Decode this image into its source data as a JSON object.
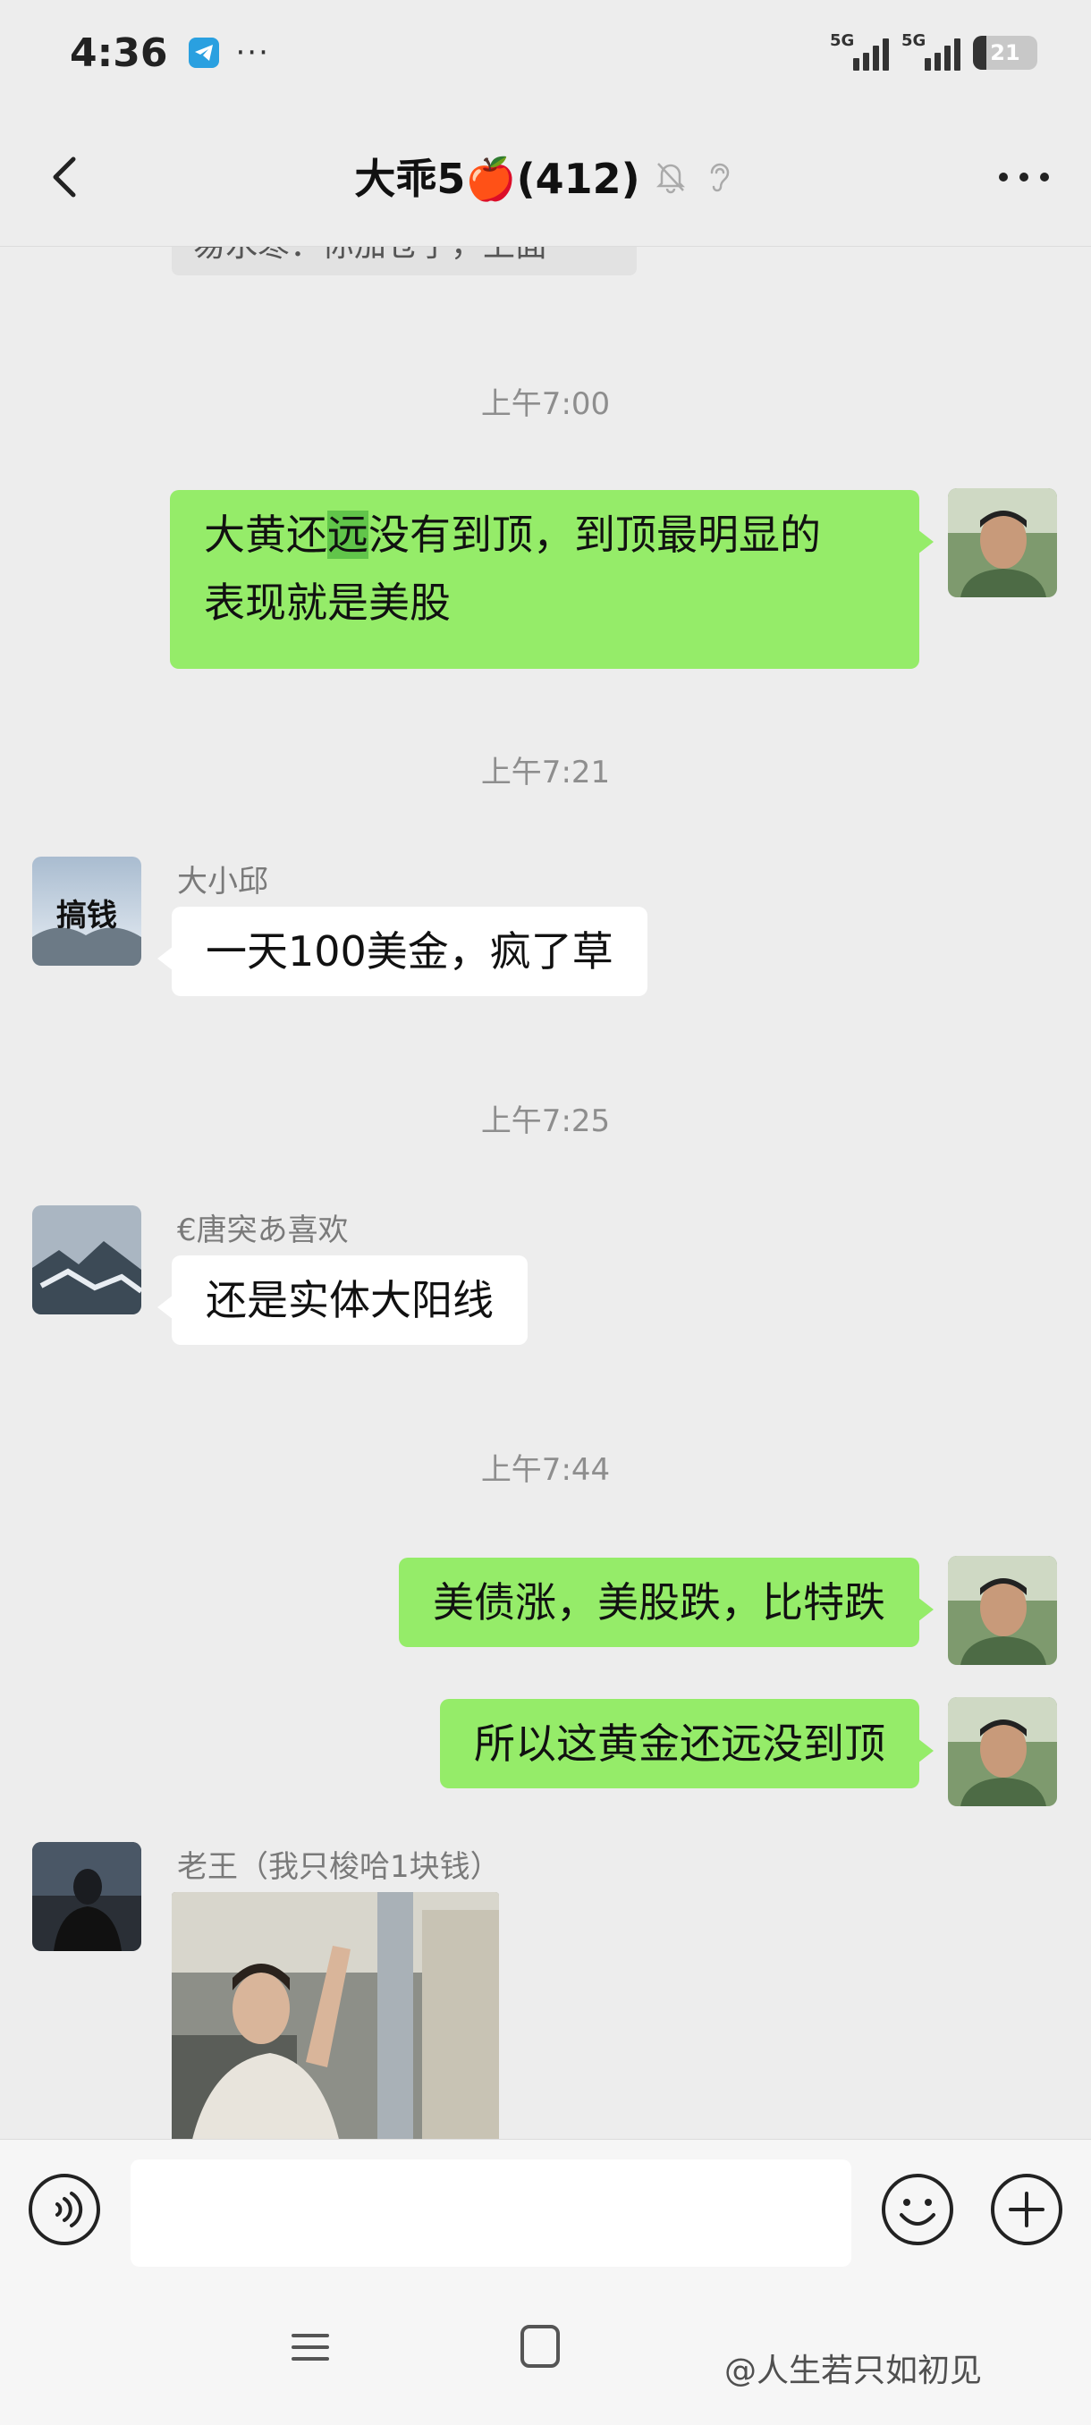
{
  "status_bar": {
    "time": "4:36",
    "dots": "···",
    "network_1": "5G",
    "network_2": "5G",
    "battery": "21",
    "battery_fraction": 0.21
  },
  "header": {
    "title": "大乖5🍎(412)"
  },
  "chat": {
    "partial_message": "易水寒：你加仓了，上面",
    "timestamps": [
      "上午7:00",
      "上午7:21",
      "上午7:25",
      "上午7:44"
    ],
    "messages": [
      {
        "type": "sent",
        "line1_pre": "大黄还",
        "line1_hl": "远",
        "line1_post": "没有到顶，到顶最明显的",
        "line2": "表现就是美股"
      },
      {
        "type": "recv",
        "sender": "大小邱",
        "avatar_text": "搞钱",
        "text": "一天100美金，疯了草"
      },
      {
        "type": "recv",
        "sender": "€唐突あ喜欢",
        "text": "还是实体大阳线"
      },
      {
        "type": "sent",
        "text": "美债涨，美股跌，比特跌"
      },
      {
        "type": "sent",
        "text": "所以这黄金还远没到顶"
      },
      {
        "type": "recv-image",
        "sender": "老王（我只梭哈1块钱）"
      }
    ]
  },
  "watermark": "@人生若只如初见",
  "colors": {
    "background": "#ededed",
    "sent_bubble": "#95ec69",
    "recv_bubble": "#ffffff",
    "highlight": "#61c54a"
  }
}
